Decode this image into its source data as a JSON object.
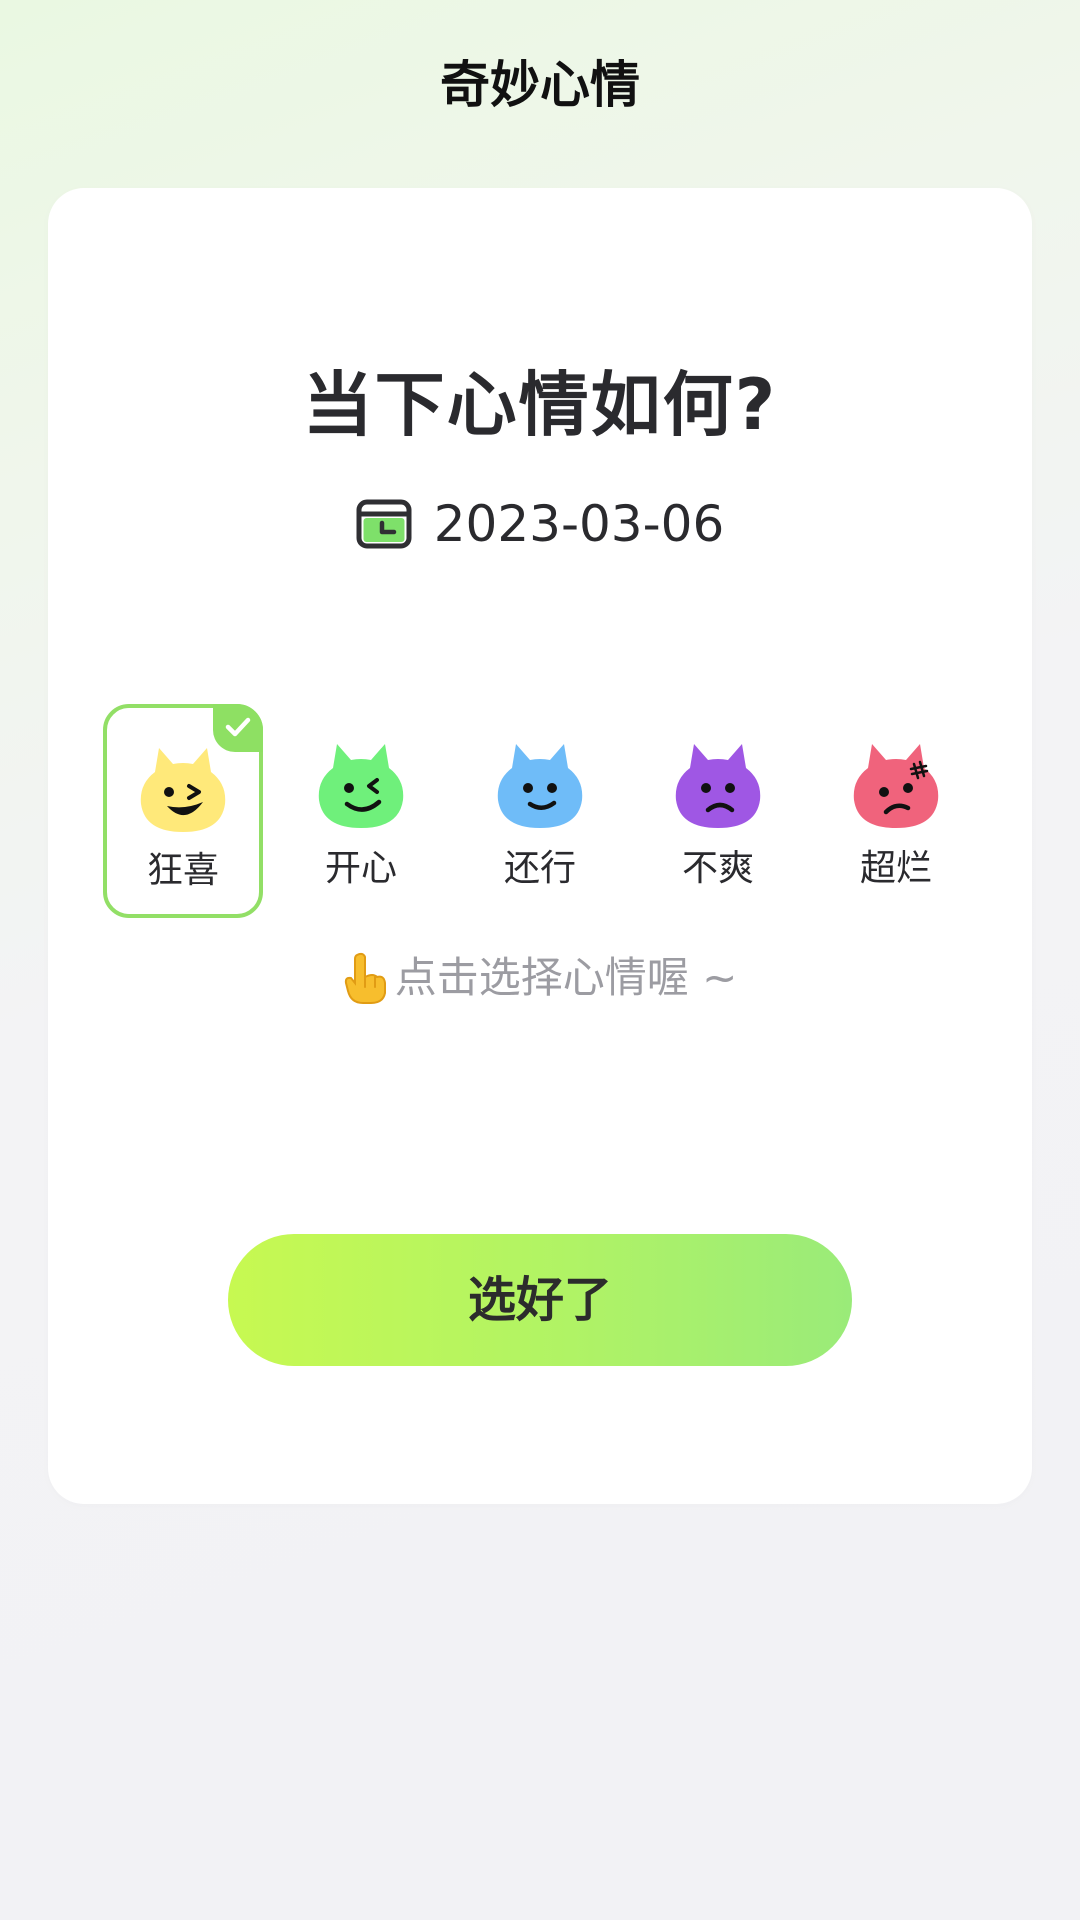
{
  "header": {
    "title": "奇妙心情"
  },
  "main": {
    "question": "当下心情如何?",
    "date": "2023-03-06",
    "hint": "点击选择心情喔 ~",
    "confirm_label": "选好了"
  },
  "moods": [
    {
      "label": "狂喜",
      "color": "#ffe97a",
      "icon": "ecstatic-face-icon",
      "selected": true
    },
    {
      "label": "开心",
      "color": "#6ff07b",
      "icon": "happy-face-icon",
      "selected": false
    },
    {
      "label": "还行",
      "color": "#6fbcf8",
      "icon": "okay-face-icon",
      "selected": false
    },
    {
      "label": "不爽",
      "color": "#9f57e4",
      "icon": "upset-face-icon",
      "selected": false
    },
    {
      "label": "超烂",
      "color": "#f0637c",
      "icon": "terrible-face-icon",
      "selected": false
    }
  ],
  "colors": {
    "accent": "#92df66",
    "button_gradient_start": "#c7f951",
    "button_gradient_end": "#9aeb79"
  }
}
